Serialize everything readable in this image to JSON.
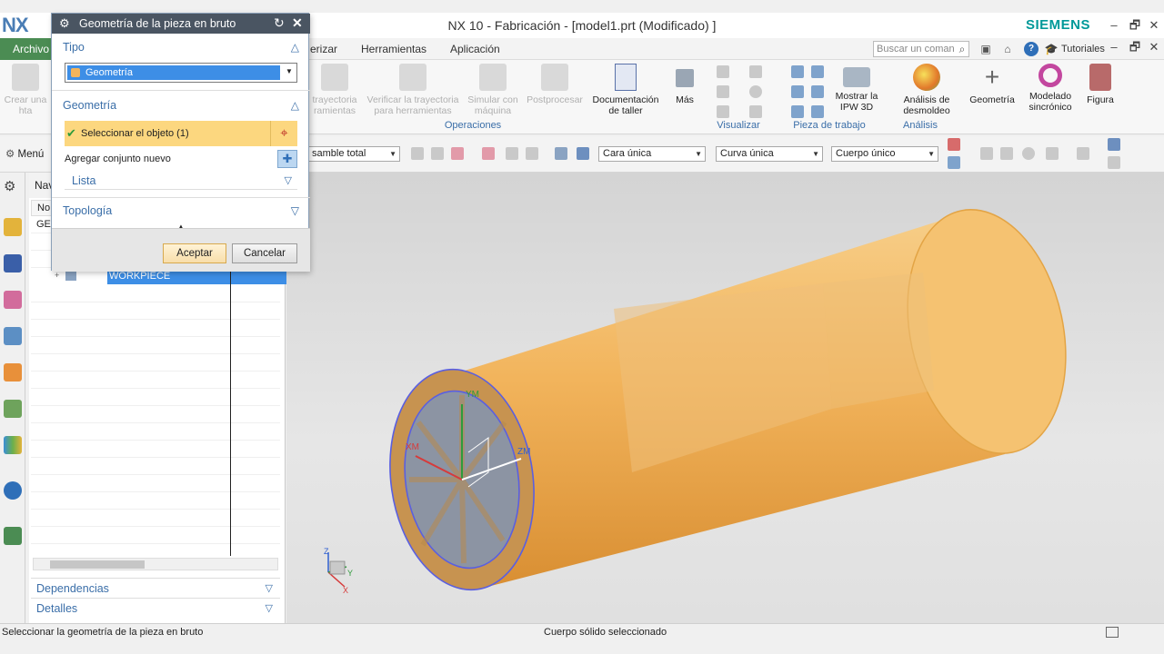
{
  "app": {
    "logo": "NX",
    "title": "NX 10 - Fabricación - [model1.prt (Modificado) ]",
    "brand": "SIEMENS",
    "window_controls": [
      "–",
      "🗗",
      "✕"
    ],
    "inner_window_controls": [
      "–",
      "🗗",
      "✕"
    ]
  },
  "menubar": {
    "file": "Archivo",
    "partial_item": "erizar",
    "items": [
      "Herramientas",
      "Aplicación"
    ],
    "search_placeholder": "Buscar un coman",
    "tutorials": "Tutoriales"
  },
  "ribbon": {
    "crear_hta": "Crear una hta",
    "trayectoria": "trayectoria ramientas",
    "verificar": "Verificar la trayectoria para herramientas",
    "simular": "Simular con máquina",
    "postprocesar": "Postprocesar",
    "documentacion": "Documentación de taller",
    "mas": "Más",
    "group_operaciones": "Operaciones",
    "group_visualizar": "Visualizar",
    "mostrar_ipw": "Mostrar la IPW 3D",
    "group_pieza": "Pieza de trabajo",
    "analisis_desmoldeo": "Análisis de desmoldeo",
    "group_analisis": "Análisis",
    "geometria": "Geometría",
    "modelado": "Modelado sincrónico",
    "figura": "Figura"
  },
  "toolbar2": {
    "menu": "Menú",
    "assembly_combo": "samble total",
    "face_combo": "Cara única",
    "curve_combo": "Curva única",
    "body_combo": "Cuerpo único"
  },
  "navigator": {
    "header": "Nav",
    "column": "No",
    "row_geo": "GEC",
    "selected_item": "WORKPIECE",
    "sections": [
      "Dependencias",
      "Detalles"
    ]
  },
  "dialog": {
    "title": "Geometría de la pieza en bruto",
    "tipo_label": "Tipo",
    "tipo_value": "Geometría",
    "geometria_label": "Geometría",
    "select_object": "Seleccionar el objeto (1)",
    "add_new_set": "Agregar conjunto nuevo",
    "list_label": "Lista",
    "topologia_label": "Topología",
    "ok": "Aceptar",
    "cancel": "Cancelar"
  },
  "viewport": {
    "axis_labels": {
      "ym": "YM",
      "xm": "XM",
      "zm": "ZM"
    },
    "triad": {
      "z": "Z",
      "y": "Y",
      "x": "X"
    },
    "part_color": "#f2b45c",
    "edge_color": "#5a5fe0"
  },
  "status": {
    "left": "Seleccionar la geometría de la pieza en bruto",
    "center": "Cuerpo sólido seleccionado"
  }
}
